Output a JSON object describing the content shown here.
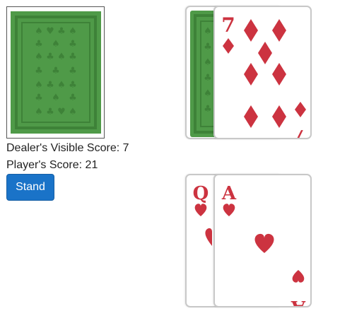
{
  "colors": {
    "card_back_green": "#4f9a48",
    "card_back_pattern": "#3e8238",
    "card_red": "#cc3340",
    "button_blue": "#1a73c8"
  },
  "deck": {
    "icon": "card-back-clubs-spades"
  },
  "dealer": {
    "score_text": "Dealer's Visible Score: 7",
    "cards": [
      {
        "face": "down"
      },
      {
        "face": "up",
        "rank": "7",
        "suit": "diamonds"
      }
    ]
  },
  "player": {
    "score_text": "Player's Score: 21",
    "cards": [
      {
        "face": "up",
        "rank": "Q",
        "suit": "hearts"
      },
      {
        "face": "up",
        "rank": "A",
        "suit": "hearts"
      }
    ]
  },
  "controls": {
    "stand_label": "Stand"
  }
}
